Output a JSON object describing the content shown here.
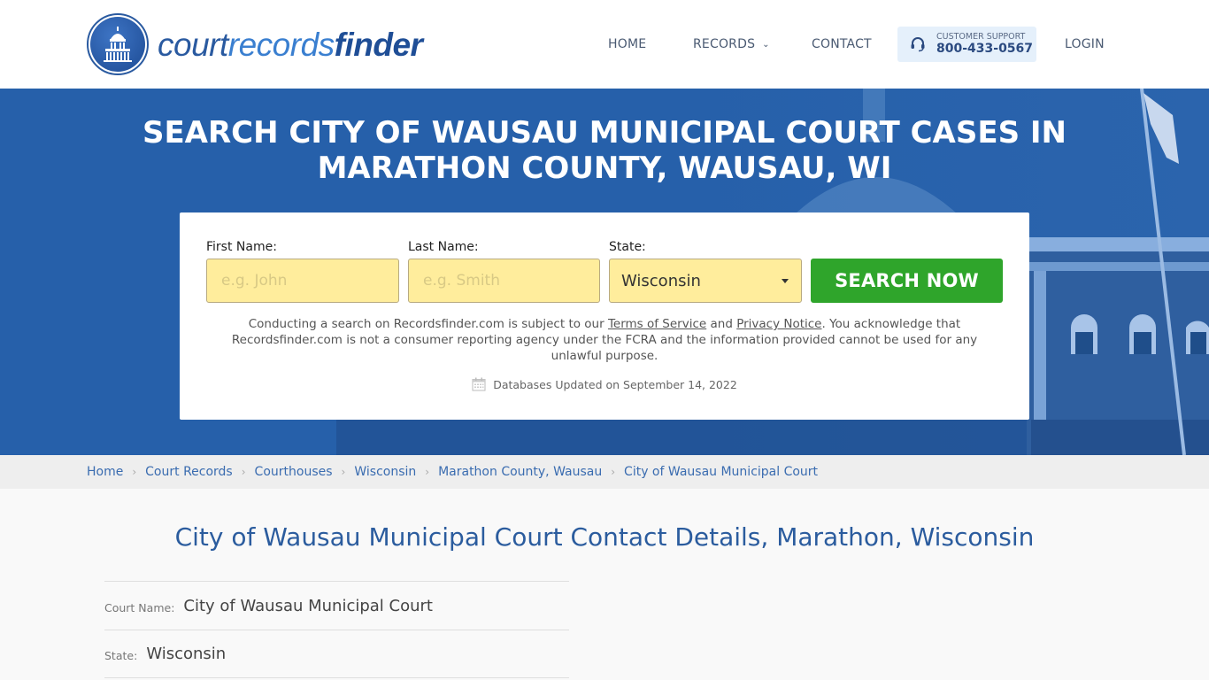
{
  "header": {
    "logo": {
      "part1": "court",
      "part2": "records",
      "part3": "finder"
    },
    "nav": {
      "home": "HOME",
      "records": "RECORDS",
      "contact": "CONTACT",
      "login": "LOGIN"
    },
    "support": {
      "label": "CUSTOMER SUPPORT",
      "phone": "800-433-0567"
    }
  },
  "hero": {
    "title_line1": "SEARCH CITY OF WAUSAU MUNICIPAL COURT CASES IN",
    "title_line2": "MARATHON COUNTY, WAUSAU, WI"
  },
  "search": {
    "first_name": {
      "label": "First Name:",
      "placeholder": "e.g. John",
      "value": ""
    },
    "last_name": {
      "label": "Last Name:",
      "placeholder": "e.g. Smith",
      "value": ""
    },
    "state": {
      "label": "State:",
      "selected": "Wisconsin"
    },
    "button": "SEARCH NOW",
    "disclaimer": {
      "part1": "Conducting a search on Recordsfinder.com is subject to our ",
      "terms_link": "Terms of Service",
      "part2": " and ",
      "privacy_link": "Privacy Notice",
      "part3": ". You acknowledge that Recordsfinder.com is not a consumer reporting agency under the FCRA and the information provided cannot be used for any unlawful purpose."
    },
    "db_updated": "Databases Updated on September 14, 2022"
  },
  "breadcrumb": [
    {
      "label": "Home"
    },
    {
      "label": "Court Records"
    },
    {
      "label": "Courthouses"
    },
    {
      "label": "Wisconsin"
    },
    {
      "label": "Marathon County, Wausau"
    },
    {
      "label": "City of Wausau Municipal Court"
    }
  ],
  "main": {
    "heading": "City of Wausau Municipal Court Contact Details, Marathon, Wisconsin",
    "details": [
      {
        "label": "Court Name:",
        "value": "City of Wausau Municipal Court"
      },
      {
        "label": "State:",
        "value": "Wisconsin"
      }
    ]
  },
  "colors": {
    "brand_blue": "#2660aa",
    "search_green": "#2fa52b",
    "input_yellow": "#ffed9c",
    "heading_blue": "#2b5c9e"
  }
}
